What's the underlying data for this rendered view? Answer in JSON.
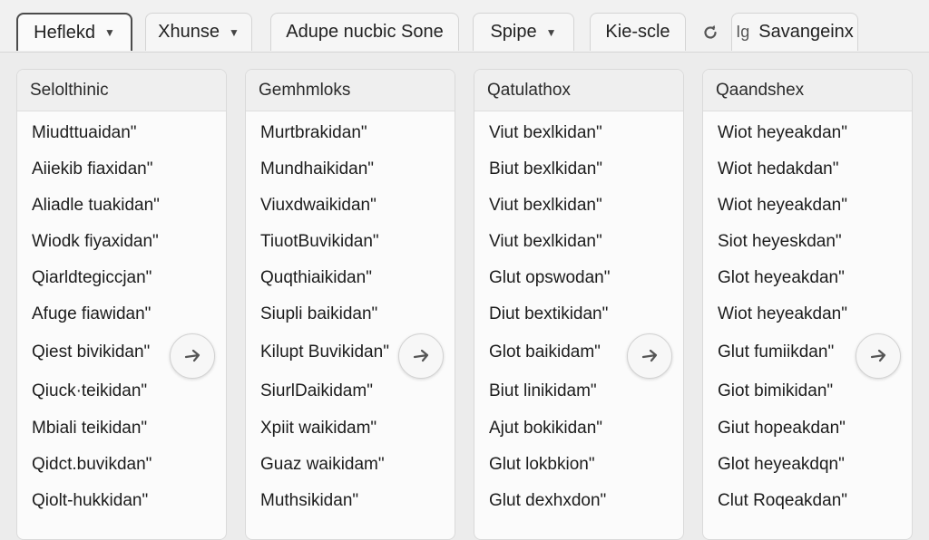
{
  "toolbar": {
    "items": [
      {
        "label": "Heflekd",
        "dropdown": true
      },
      {
        "label": "Xhunse",
        "dropdown": true
      },
      {
        "label": "Adupe nucbic Sone",
        "dropdown": false
      },
      {
        "label": "Spipe",
        "dropdown": true
      },
      {
        "label": "Kie-scle",
        "dropdown": false
      }
    ],
    "refresh_icon": "refresh-icon",
    "last_tab_glyph": "Ig",
    "last_tab_label": "Savangeinx"
  },
  "columns": [
    {
      "header": "Selolthinic",
      "items": [
        "Miudttuaidan\"",
        "Aiiekib fiaxidan\"",
        "Aliadle tuakidan\"",
        "Wiodk fiyaxidan\"",
        "Qiarldtegiccjan\"",
        "Afuge fiawidan\"",
        "Qiest bivikidan\"",
        "Qiuck·teikidan\"",
        "Mbiali teikidan\"",
        "Qidct.buvikdan\"",
        "Qiolt-hukkidan\""
      ]
    },
    {
      "header": "Gemhmloks",
      "items": [
        "Murtbrakidan\"",
        "Mundhaikidan\"",
        "Viuxdwaikidan\"",
        "TiuotBuvikidan\"",
        "Quqthiaikidan\"",
        "Siupli baikidan\"",
        "Kilupt Buvikidan\"",
        "SiurlDaikidam\"",
        "Xpiit waikidam\"",
        "Guaz waikidam\"",
        "Muthsikidan\""
      ]
    },
    {
      "header": "Qatulathox",
      "items": [
        "Viut bexlkidan\"",
        "Biut bexlkidan\"",
        "Viut bexlkidan\"",
        "Viut bexlkidan\"",
        "Glut opswodan\"",
        "Diut bextikidan\"",
        "Glot baikidam\"",
        "Biut linikidam\"",
        "Ajut bokikidan\"",
        "Glut lokbkion\"",
        "Glut dexhxdon\""
      ]
    },
    {
      "header": "Qaandshex",
      "items": [
        "Wiot heyeakdan\"",
        "Wiot hedakdan\"",
        "Wiot heyeakdan\"",
        "Siot heyeskdan\"",
        "Glot heyeakdan\"",
        "Wiot heyeakdan\"",
        "Glut fumiikdan\"",
        "Giot bimikidan\"",
        "Giut hopeakdan\"",
        "Glot heyeakdqn\"",
        "Clut Roqeakdan\""
      ]
    }
  ],
  "fab_icon": "arrow-right-icon",
  "colors": {
    "background": "#ececec",
    "panel": "#fbfbfb",
    "header": "#efefef",
    "border": "#dadada",
    "active_tab_border": "#4b4b4b"
  }
}
